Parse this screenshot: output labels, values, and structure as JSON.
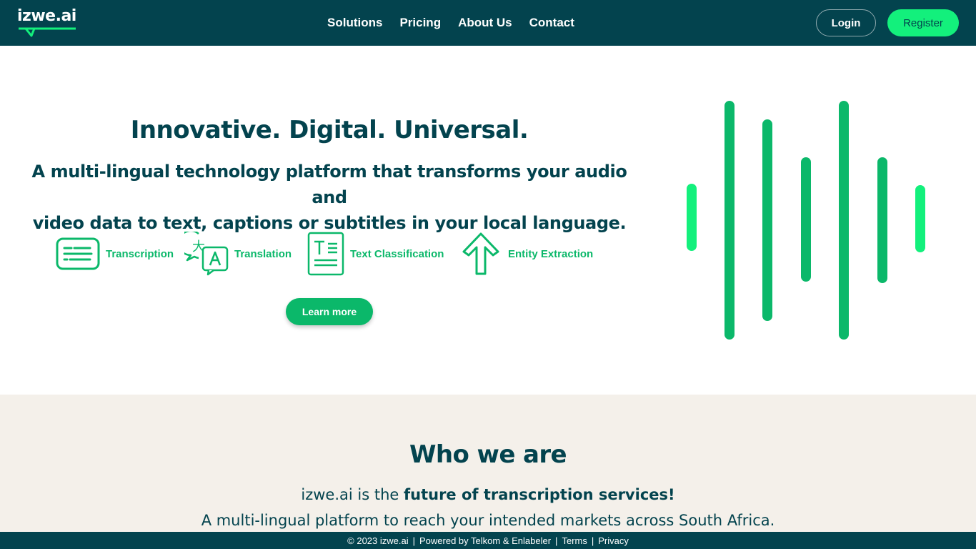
{
  "header": {
    "logo_text": "izwe.ai",
    "nav": [
      "Solutions",
      "Pricing",
      "About Us",
      "Contact"
    ],
    "login_label": "Login",
    "register_label": "Register"
  },
  "hero": {
    "title": "Innovative. Digital. Universal.",
    "subtitle_line1": "A multi-lingual technology platform that transforms your audio and",
    "subtitle_line2": "video data to text, captions or subtitles in your local language.",
    "features": [
      {
        "label": "Transcription",
        "icon": "transcription-icon"
      },
      {
        "label": "Translation",
        "icon": "translation-icon"
      },
      {
        "label": "Text Classification",
        "icon": "text-classification-icon"
      },
      {
        "label": "Entity Extraction",
        "icon": "entity-extraction-icon"
      }
    ],
    "cta_label": "Learn more"
  },
  "about": {
    "title": "Who we are",
    "line1_prefix": "izwe.ai is the ",
    "line1_bold": "future of transcription services!",
    "line2": "A multi-lingual platform to reach your intended markets across South Africa."
  },
  "footer": {
    "copyright": "© 2023 izwe.ai",
    "powered": "Powered by Telkom & Enlabeler",
    "terms": "Terms",
    "privacy": "Privacy"
  },
  "colors": {
    "navy": "#03434e",
    "green": "#0bb86a",
    "bright_green": "#13f07c",
    "beige": "#f4f0ea"
  }
}
